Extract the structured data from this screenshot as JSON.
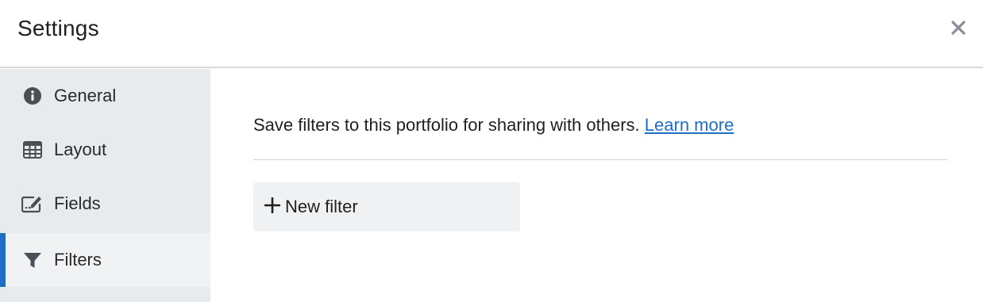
{
  "header": {
    "title": "Settings",
    "close_icon": "close-icon"
  },
  "sidebar": {
    "items": [
      {
        "label": "General",
        "icon": "info-circle-icon",
        "active": false
      },
      {
        "label": "Layout",
        "icon": "table-grid-icon",
        "active": false
      },
      {
        "label": "Fields",
        "icon": "edit-field-icon",
        "active": false
      },
      {
        "label": "Filters",
        "icon": "filter-funnel-icon",
        "active": true
      }
    ]
  },
  "main": {
    "description": "Save filters to this portfolio for sharing with others.",
    "learn_more": "Learn more",
    "new_filter_label": "New filter",
    "new_filter_icon": "plus-icon"
  },
  "colors": {
    "accent": "#1f6fc5",
    "sidebar_bg": "#e8ebee",
    "active_bg": "#f1f2f4",
    "button_bg": "#f0f1f3"
  }
}
